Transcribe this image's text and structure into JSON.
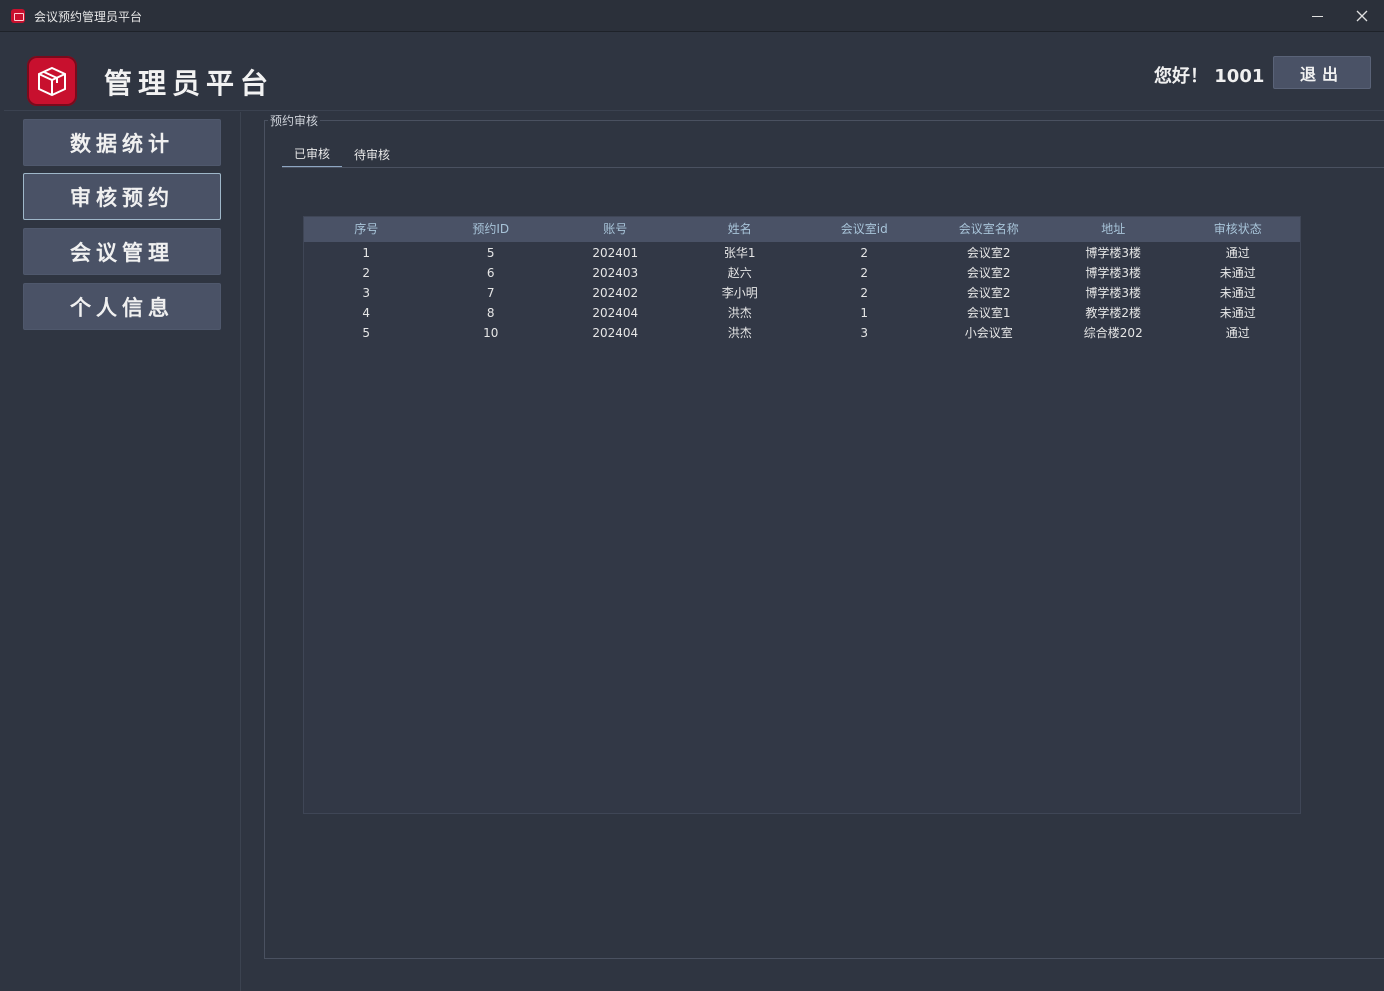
{
  "window": {
    "title": "会议预约管理员平台"
  },
  "header": {
    "title": "管理员平台",
    "greeting": "您好！ 1001",
    "logout_label": "退出"
  },
  "sidebar": {
    "items": [
      {
        "label": "数据统计"
      },
      {
        "label": "审核预约"
      },
      {
        "label": "会议管理"
      },
      {
        "label": "个人信息"
      }
    ],
    "active_index": 1
  },
  "panel": {
    "legend": "预约审核",
    "tabs": [
      {
        "label": "已审核"
      },
      {
        "label": "待审核"
      }
    ]
  },
  "table": {
    "columns": [
      "序号",
      "预约ID",
      "账号",
      "姓名",
      "会议室id",
      "会议室名称",
      "地址",
      "审核状态"
    ],
    "rows": [
      [
        "1",
        "5",
        "202401",
        "张华1",
        "2",
        "会议室2",
        "博学楼3楼",
        "通过"
      ],
      [
        "2",
        "6",
        "202403",
        "赵六",
        "2",
        "会议室2",
        "博学楼3楼",
        "未通过"
      ],
      [
        "3",
        "7",
        "202402",
        "李小明",
        "2",
        "会议室2",
        "博学楼3楼",
        "未通过"
      ],
      [
        "4",
        "8",
        "202404",
        "洪杰",
        "1",
        "会议室1",
        "教学楼2楼",
        "未通过"
      ],
      [
        "5",
        "10",
        "202404",
        "洪杰",
        "3",
        "小会议室",
        "综合楼202",
        "通过"
      ]
    ]
  },
  "colors": {
    "background": "#2f3541",
    "button": "#4a5266",
    "accent": "#c8102e",
    "header_text": "#a8c4d9"
  }
}
